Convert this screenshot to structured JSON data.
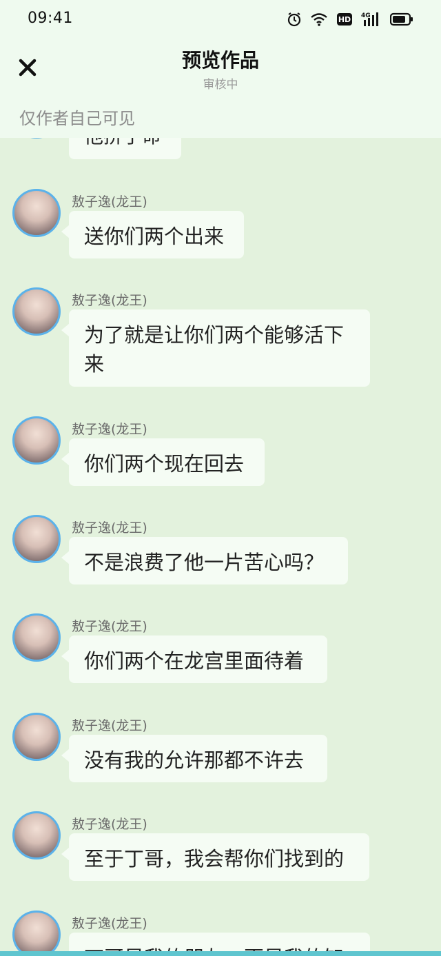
{
  "status": {
    "time": "09:41",
    "icons": [
      "alarm-icon",
      "wifi-icon",
      "hd-icon",
      "signal-4g-icon",
      "battery-icon"
    ],
    "hd_label": "HD",
    "net_label": "4G"
  },
  "header": {
    "title": "预览作品",
    "subtitle": "审核中",
    "notice": "仅作者自己可见"
  },
  "partial_message": {
    "text": "他拼了命"
  },
  "messages": [
    {
      "sender": "敖子逸(龙王)",
      "text": "送你们两个出来"
    },
    {
      "sender": "敖子逸(龙王)",
      "text": "为了就是让你们两个能够活下来"
    },
    {
      "sender": "敖子逸(龙王)",
      "text": "你们两个现在回去"
    },
    {
      "sender": "敖子逸(龙王)",
      "text": "不是浪费了他一片苦心吗？"
    },
    {
      "sender": "敖子逸(龙王)",
      "text": "你们两个在龙宫里面待着"
    },
    {
      "sender": "敖子逸(龙王)",
      "text": "没有我的允许那都不许去"
    },
    {
      "sender": "敖子逸(龙王)",
      "text": "至于丁哥，我会帮你们找到的"
    },
    {
      "sender": "敖子逸(龙王)",
      "text": "丁哥是我的朋友，更是我的知"
    }
  ],
  "colors": {
    "background": "#e3f2dd",
    "bubble": "#f5fcf4",
    "avatar_ring": "#5bb2ea",
    "bottom_accent": "#5fc5cf"
  }
}
